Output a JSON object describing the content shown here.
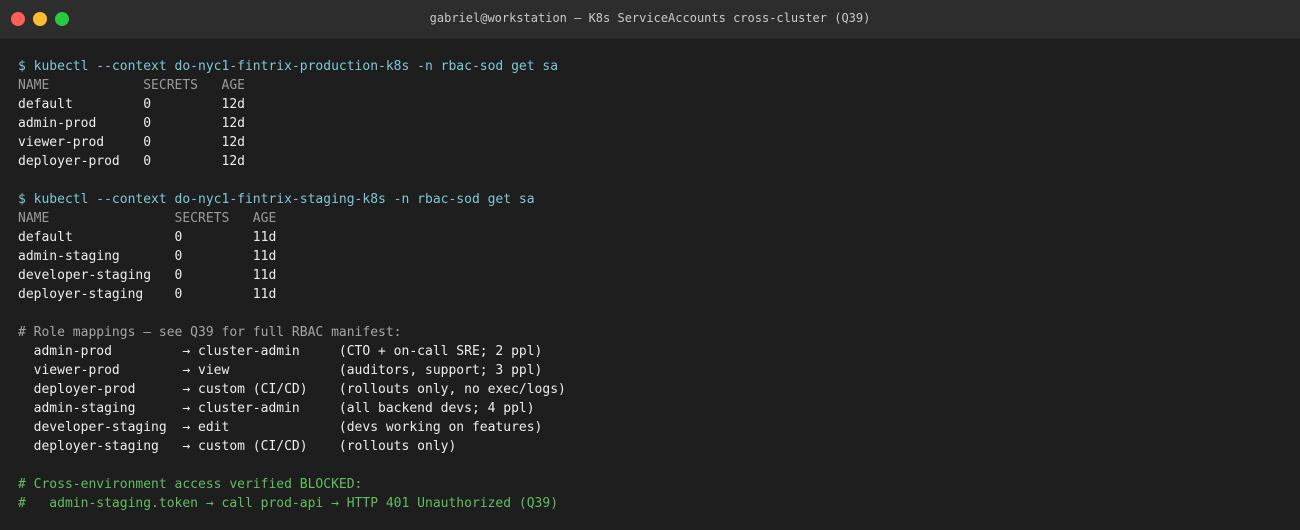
{
  "window": {
    "title": "gabriel@workstation — K8s ServiceAccounts cross-cluster (Q39)"
  },
  "blocks": {
    "prod": {
      "command": "$ kubectl --context do-nyc1-fintrix-production-k8s -n rbac-sod get sa",
      "header": "NAME            SECRETS   AGE",
      "rows": [
        "default         0         12d",
        "admin-prod      0         12d",
        "viewer-prod     0         12d",
        "deployer-prod   0         12d"
      ]
    },
    "staging": {
      "command": "$ kubectl --context do-nyc1-fintrix-staging-k8s -n rbac-sod get sa",
      "header": "NAME                SECRETS   AGE",
      "rows": [
        "default             0         11d",
        "admin-staging       0         11d",
        "developer-staging   0         11d",
        "deployer-staging    0         11d"
      ]
    },
    "mappings": {
      "comment": "# Role mappings — see Q39 for full RBAC manifest:",
      "rows": [
        "  admin-prod         → cluster-admin     (CTO + on-call SRE; 2 ppl)",
        "  viewer-prod        → view              (auditors, support; 3 ppl)",
        "  deployer-prod      → custom (CI/CD)    (rollouts only, no exec/logs)",
        "  admin-staging      → cluster-admin     (all backend devs; 4 ppl)",
        "  developer-staging  → edit              (devs working on features)",
        "  deployer-staging   → custom (CI/CD)    (rollouts only)"
      ]
    },
    "verify": {
      "line1": "# Cross-environment access verified BLOCKED:",
      "line2": "#   admin-staging.token → call prod-api → HTTP 401 Unauthorized (Q39)"
    }
  },
  "colors": {
    "command": "#7ec7d6",
    "success_comment": "#5fbf5f",
    "background": "#1e1e1e"
  }
}
